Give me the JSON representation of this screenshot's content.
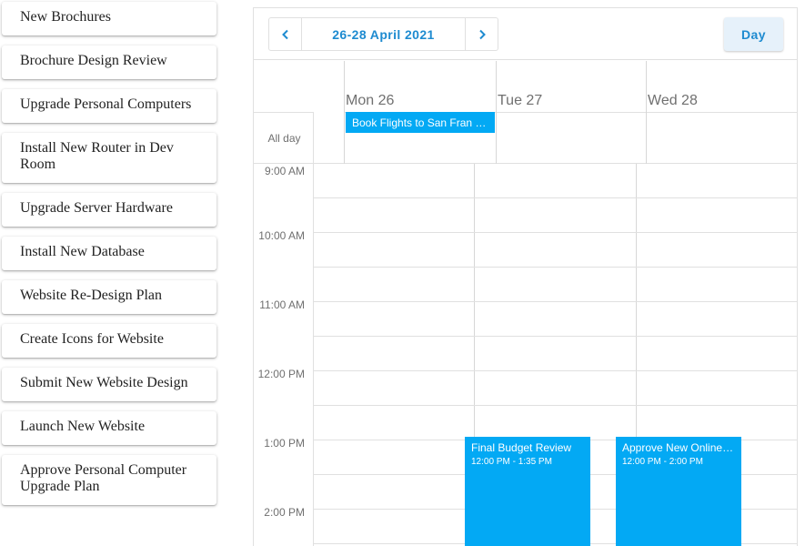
{
  "tasks": [
    "New Brochures",
    "Brochure Design Review",
    "Upgrade Personal Computers",
    "Install New Router in Dev Room",
    "Upgrade Server Hardware",
    "Install New Database",
    "Website Re-Design Plan",
    "Create Icons for Website",
    "Submit New Website Design",
    "Launch New Website",
    "Approve Personal Computer Upgrade Plan"
  ],
  "scheduler": {
    "date_range": "26-28 April 2021",
    "view_label": "Day",
    "prev_icon": "chevron-left-icon",
    "next_icon": "chevron-right-icon",
    "days": [
      "Mon 26",
      "Tue 27",
      "Wed 28"
    ],
    "all_day_label": "All day",
    "time_labels": [
      "9:00 AM",
      "10:00 AM",
      "11:00 AM",
      "12:00 PM",
      "1:00 PM",
      "2:00 PM"
    ],
    "all_day_events": [
      {
        "title": "Book Flights to San Fran for Sales Trip",
        "day": "Mon 26"
      }
    ],
    "appointments": [
      {
        "title": "Final Budget Review",
        "time": "12:00 PM - 1:35 PM",
        "day": "Tue 27"
      },
      {
        "title": "Approve New Online Marketing Strategy",
        "time": "12:00 PM - 2:00 PM",
        "day": "Wed 28"
      }
    ]
  },
  "colors": {
    "accent": "#1e8bd0",
    "appointment": "#03a9f4",
    "view_button_bg": "#e6f1fa",
    "grid_line": "#e0e0e0",
    "muted_text": "#707070"
  }
}
